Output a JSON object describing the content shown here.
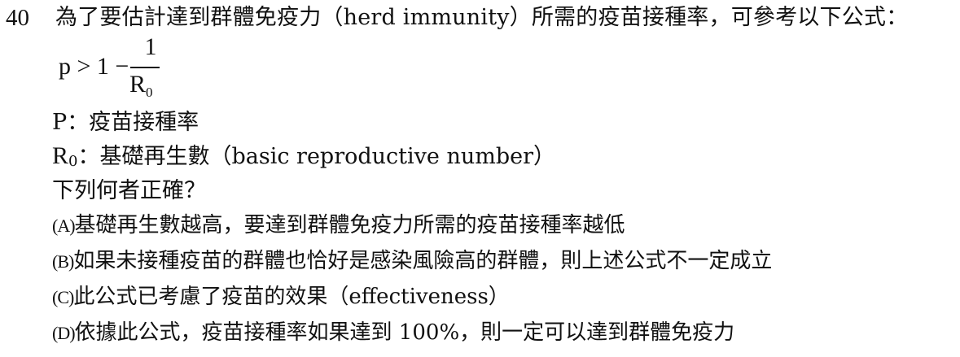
{
  "question": {
    "number": "40",
    "stem": "為了要估計達到群體免疫力（herd immunity）所需的疫苗接種率，可參考以下公式："
  },
  "formula": {
    "lhs": "p > 1 −",
    "numerator": "1",
    "denominator_base": "R",
    "denominator_sub": "0"
  },
  "definitions": {
    "p_label": "P：疫苗接種率",
    "r0_symbol": "R",
    "r0_sub": "0",
    "r0_text": "：基礎再生數（basic reproductive number）"
  },
  "prompt": "下列何者正確？",
  "options": [
    {
      "label": "(A)",
      "text": "基礎再生數越高，要達到群體免疫力所需的疫苗接種率越低"
    },
    {
      "label": "(B)",
      "text": "如果未接種疫苗的群體也恰好是感染風險高的群體，則上述公式不一定成立"
    },
    {
      "label": "(C)",
      "text": "此公式已考慮了疫苗的效果（effectiveness）"
    },
    {
      "label": "(D)",
      "text": "依據此公式，疫苗接種率如果達到 100%，則一定可以達到群體免疫力"
    }
  ]
}
